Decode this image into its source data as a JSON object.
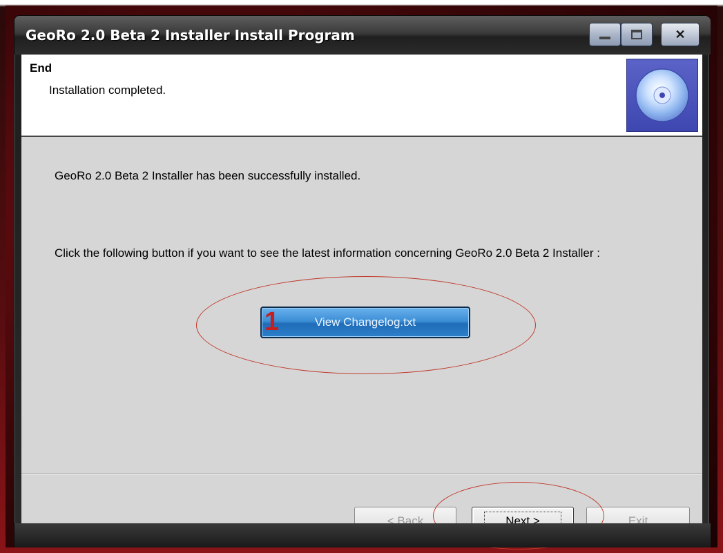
{
  "window": {
    "title": "GeoRo 2.0 Beta 2 Installer Install Program",
    "controls": {
      "minimize": "minimize",
      "maximize": "maximize",
      "close": "✕"
    }
  },
  "header": {
    "title": "End",
    "subtitle": "Installation completed.",
    "icon": "cd-icon"
  },
  "content": {
    "success_message": "GeoRo 2.0 Beta 2 Installer has been successfully installed.",
    "changelog_prompt": "Click the following button if you want to see the latest information concerning GeoRo 2.0 Beta 2 Installer :",
    "changelog_button": "View Changelog.txt",
    "annotation_marker": "1"
  },
  "footer": {
    "back_label": "< Back",
    "next_label": "Next >",
    "exit_label": "Exit"
  },
  "colors": {
    "annotation": "#c0392b",
    "changelog_button": "#3c8fd6",
    "panel_background": "#d6d6d6"
  }
}
